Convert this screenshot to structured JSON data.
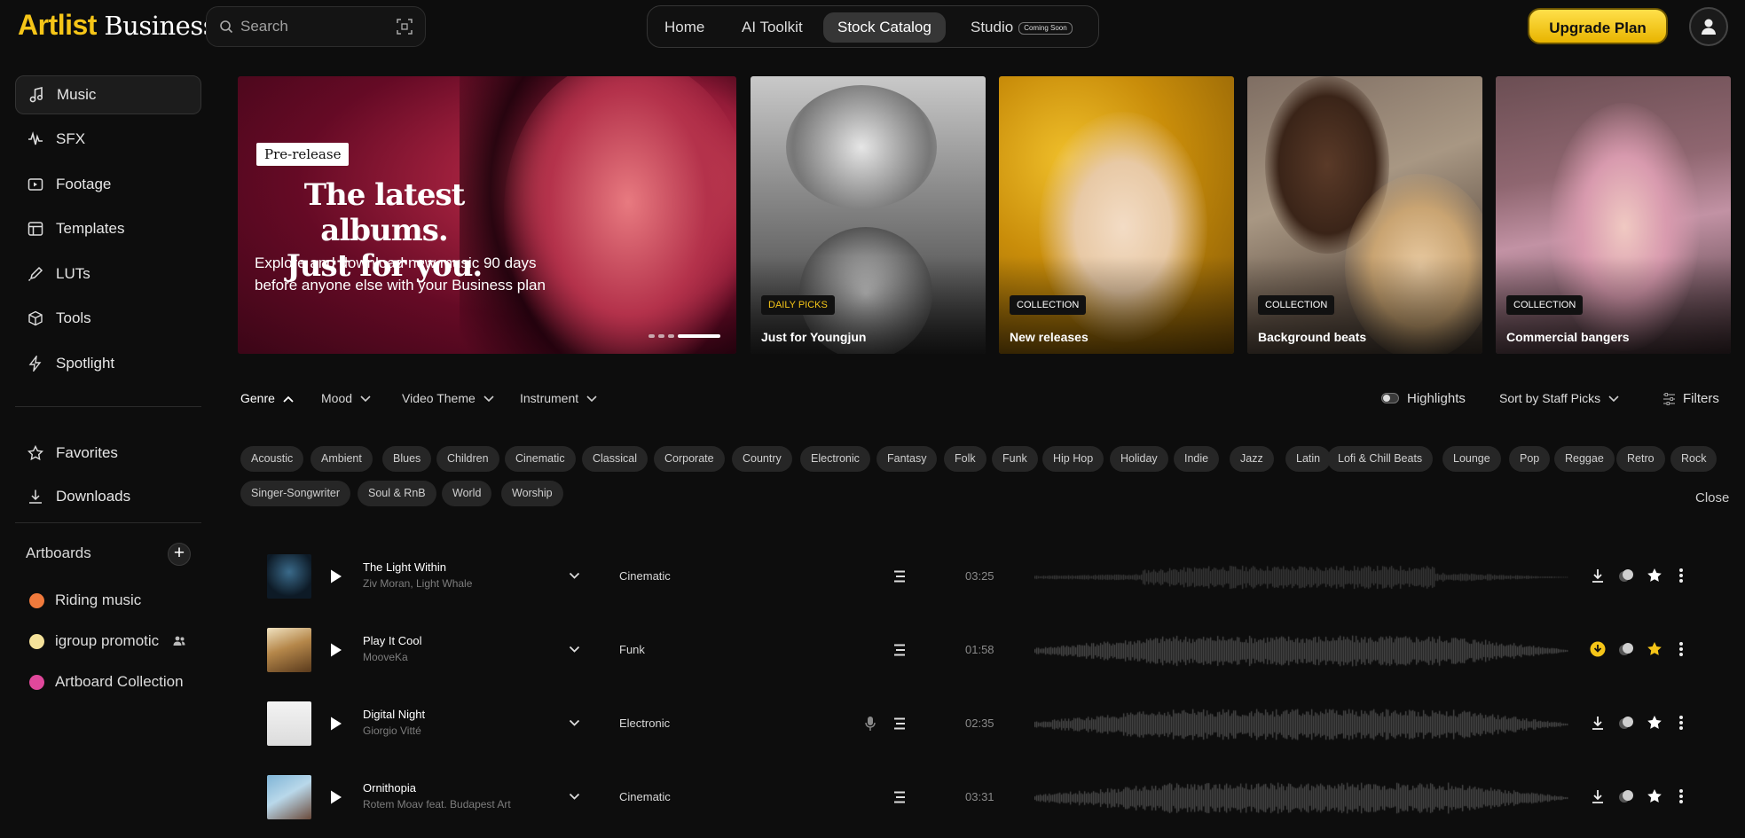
{
  "header": {
    "logo_brand": "Artlist",
    "logo_suffix": "Business",
    "search_placeholder": "Search",
    "nav": [
      {
        "label": "Home"
      },
      {
        "label": "AI Toolkit"
      },
      {
        "label": "Stock Catalog",
        "active": true
      },
      {
        "label": "Studio",
        "badge": "Coming Soon"
      }
    ],
    "upgrade_label": "Upgrade Plan"
  },
  "sidebar": {
    "items": [
      {
        "label": "Music",
        "icon": "music-note-icon",
        "active": true
      },
      {
        "label": "SFX",
        "icon": "waveform-icon"
      },
      {
        "label": "Footage",
        "icon": "video-icon"
      },
      {
        "label": "Templates",
        "icon": "template-icon"
      },
      {
        "label": "LUTs",
        "icon": "eyedropper-icon"
      },
      {
        "label": "Tools",
        "icon": "cube-icon"
      },
      {
        "label": "Spotlight",
        "icon": "lightning-icon"
      }
    ],
    "secondary": [
      {
        "label": "Favorites",
        "icon": "star-icon"
      },
      {
        "label": "Downloads",
        "icon": "download-icon"
      }
    ],
    "artboards_title": "Artboards",
    "artboards": [
      {
        "label": "Riding music",
        "color": "#f07a3c"
      },
      {
        "label": "igroup promotic",
        "color": "#f5e29a",
        "shared": true
      },
      {
        "label": "Artboard Collection",
        "color": "#e0489b"
      }
    ]
  },
  "hero": {
    "badge": "Pre-release",
    "title_line1": "The latest albums.",
    "title_line2": "Just for you.",
    "text": "Explore and download new music 90 days before anyone else with your Business plan"
  },
  "cards": [
    {
      "tag": "DAILY PICKS",
      "title": "Just for Youngjun"
    },
    {
      "tag": "COLLECTION",
      "title": "New releases"
    },
    {
      "tag": "COLLECTION",
      "title": "Background beats"
    },
    {
      "tag": "COLLECTION",
      "title": "Commercial bangers"
    }
  ],
  "filters": {
    "genre": "Genre",
    "mood": "Mood",
    "video_theme": "Video Theme",
    "instrument": "Instrument",
    "highlights": "Highlights",
    "sort": "Sort by Staff Picks",
    "filters": "Filters",
    "close": "Close"
  },
  "genres": [
    "Acoustic",
    "Ambient",
    "Blues",
    "Children",
    "Cinematic",
    "Classical",
    "Corporate",
    "Country",
    "Electronic",
    "Fantasy",
    "Folk",
    "Funk",
    "Hip Hop",
    "Holiday",
    "Indie",
    "Jazz",
    "Latin",
    "Lofi & Chill Beats",
    "Lounge",
    "Pop",
    "Reggae",
    "Retro",
    "Rock",
    "Singer-Songwriter",
    "Soul & RnB",
    "World",
    "Worship"
  ],
  "tracks": [
    {
      "title": "The Light Within",
      "artist": "Ziv Moran, Light Whale",
      "genre": "Cinematic",
      "duration": "03:25",
      "downloaded": false,
      "favorite": false,
      "vocals": false
    },
    {
      "title": "Play It Cool",
      "artist": "MooveKa",
      "genre": "Funk",
      "duration": "01:58",
      "downloaded": true,
      "favorite": true,
      "vocals": false
    },
    {
      "title": "Digital Night",
      "artist": "Giorgio Vitté",
      "genre": "Electronic",
      "duration": "02:35",
      "downloaded": false,
      "favorite": false,
      "vocals": true
    },
    {
      "title": "Ornithopia",
      "artist": "Rotem Moav feat. Budapest Art",
      "genre": "Cinematic",
      "duration": "03:31",
      "downloaded": false,
      "favorite": false,
      "vocals": false
    }
  ],
  "colors": {
    "accent": "#f5c518",
    "background": "#0d0d0d"
  }
}
